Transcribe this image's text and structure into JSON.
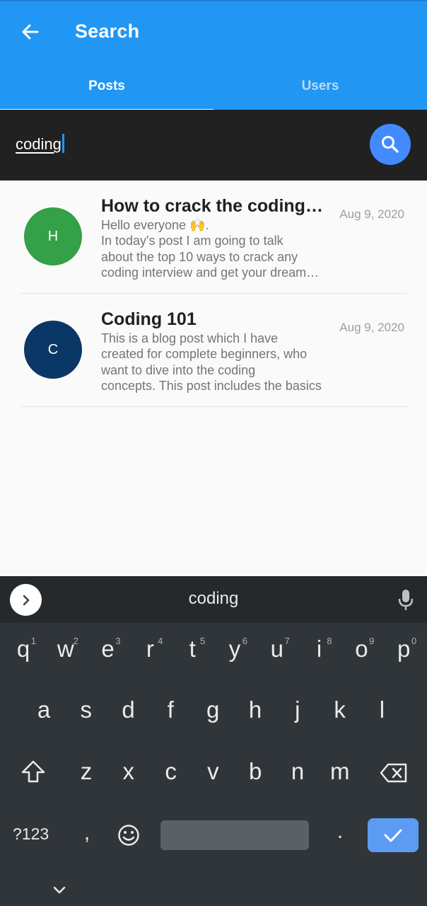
{
  "appbar": {
    "title": "Search",
    "back_icon": "arrow-left-icon",
    "color": "#2196f3",
    "tabs": [
      {
        "label": "Posts",
        "active": true
      },
      {
        "label": "Users",
        "active": false
      }
    ]
  },
  "search": {
    "value": "coding",
    "button_icon": "search-icon",
    "button_color": "#448aff"
  },
  "posts": [
    {
      "avatar_letter": "H",
      "avatar_color": "#34a048",
      "title": "How to crack the coding interview",
      "body_lines": [
        "Hello everyone 🙌.",
        "In today's post I am going to talk",
        "about the top 10 ways to crack any",
        "coding interview and get your dream job"
      ],
      "date": "Aug 9, 2020"
    },
    {
      "avatar_letter": "C",
      "avatar_color": "#0b3766",
      "title": "Coding 101",
      "body_lines": [
        "This is a blog post which I have",
        "created for complete beginners, who",
        "want to dive into the coding",
        "concepts. This post includes the basics"
      ],
      "date": "Aug 9, 2020"
    }
  ],
  "keyboard": {
    "suggestion": "coding",
    "row1": [
      {
        "key": "q",
        "hint": "1"
      },
      {
        "key": "w",
        "hint": "2"
      },
      {
        "key": "e",
        "hint": "3"
      },
      {
        "key": "r",
        "hint": "4"
      },
      {
        "key": "t",
        "hint": "5"
      },
      {
        "key": "y",
        "hint": "6"
      },
      {
        "key": "u",
        "hint": "7"
      },
      {
        "key": "i",
        "hint": "8"
      },
      {
        "key": "o",
        "hint": "9"
      },
      {
        "key": "p",
        "hint": "0"
      }
    ],
    "row2": [
      "a",
      "s",
      "d",
      "f",
      "g",
      "h",
      "j",
      "k",
      "l"
    ],
    "row3": [
      "z",
      "x",
      "c",
      "v",
      "b",
      "n",
      "m"
    ],
    "symbols_label": "?123",
    "comma": ",",
    "period": ".",
    "icons": {
      "expand": "chevron-right-icon",
      "mic": "microphone-icon",
      "shift": "shift-icon",
      "backspace": "backspace-icon",
      "emoji": "emoji-icon",
      "enter": "checkmark-icon",
      "hide": "chevron-down-icon"
    }
  }
}
